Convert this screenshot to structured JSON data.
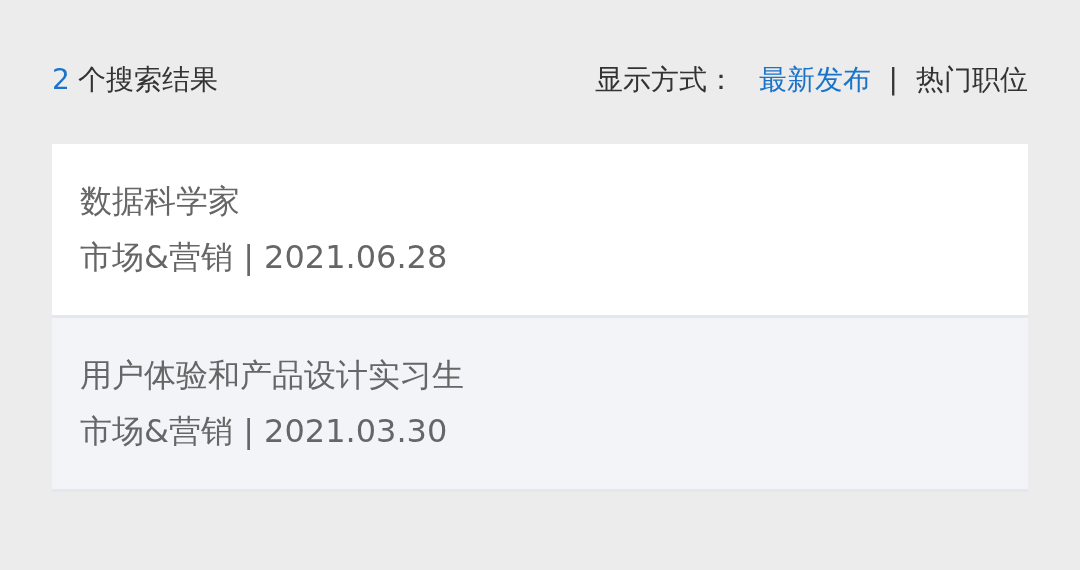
{
  "results": {
    "count": "2",
    "label": "个搜索结果"
  },
  "sort": {
    "label": "显示方式：",
    "separator": "|",
    "options": [
      {
        "label": "最新发布",
        "selected": true
      },
      {
        "label": "热门职位",
        "selected": false
      }
    ]
  },
  "jobs": [
    {
      "title": "数据科学家",
      "meta": "市场&营销 | 2021.06.28",
      "highlighted": false
    },
    {
      "title": "用户体验和产品设计实习生",
      "meta": "市场&营销 | 2021.03.30",
      "highlighted": true
    }
  ]
}
